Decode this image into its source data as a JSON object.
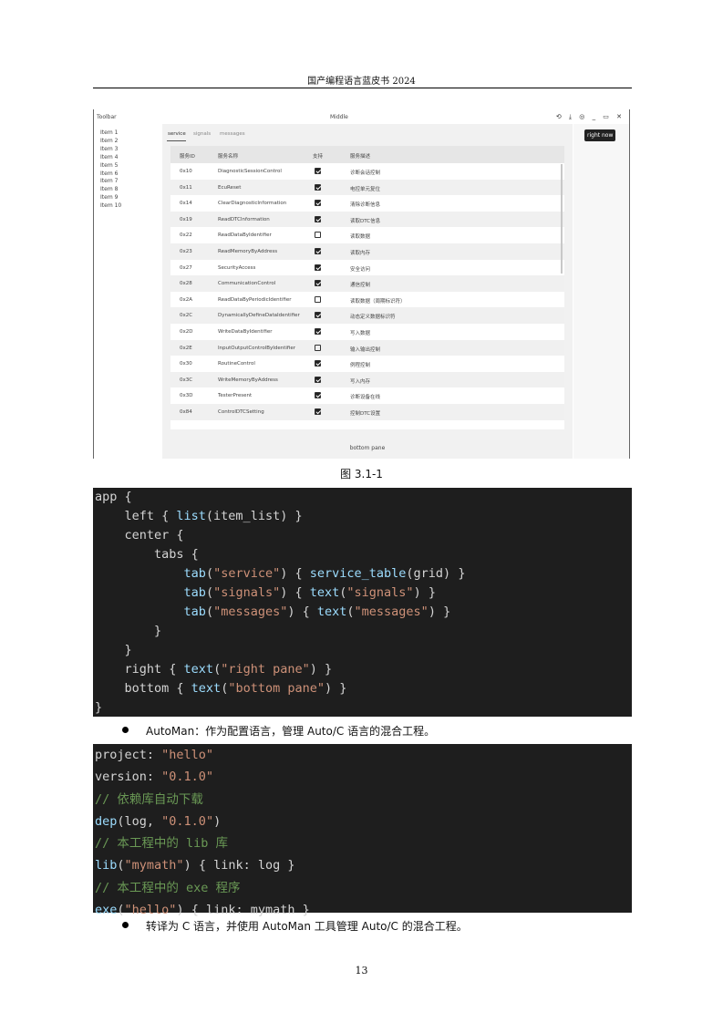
{
  "header": {
    "title": "国产编程语言蓝皮书 2024"
  },
  "figure": {
    "window": {
      "left_title": "Toolbar",
      "center_title": "Middle",
      "window_icons": "⟲ ⤓ ◎ _ ▭ ✕"
    },
    "sidebar": {
      "items": [
        "Item 1",
        "Item 2",
        "Item 3",
        "Item 4",
        "Item 5",
        "Item 6",
        "Item 7",
        "Item 8",
        "Item 9",
        "Item 10"
      ]
    },
    "tabs": [
      "service",
      "signals",
      "messages"
    ],
    "table": {
      "headers": [
        "服务ID",
        "服务名称",
        "支持",
        "服务描述"
      ],
      "rows": [
        {
          "id": "0x10",
          "name": "DiagnosticSessionControl",
          "supported": true,
          "desc": "诊断会话控制"
        },
        {
          "id": "0x11",
          "name": "EcuReset",
          "supported": true,
          "desc": "电控单元复位"
        },
        {
          "id": "0x14",
          "name": "ClearDiagnosticInformation",
          "supported": true,
          "desc": "清除诊断信息"
        },
        {
          "id": "0x19",
          "name": "ReadDTCInformation",
          "supported": true,
          "desc": "读取DTC信息"
        },
        {
          "id": "0x22",
          "name": "ReadDataByIdentifier",
          "supported": false,
          "desc": "读取数据"
        },
        {
          "id": "0x23",
          "name": "ReadMemoryByAddress",
          "supported": true,
          "desc": "读取内存"
        },
        {
          "id": "0x27",
          "name": "SecurityAccess",
          "supported": true,
          "desc": "安全访问"
        },
        {
          "id": "0x28",
          "name": "CommunicationControl",
          "supported": true,
          "desc": "通信控制"
        },
        {
          "id": "0x2A",
          "name": "ReadDataByPeriodicIdentifier",
          "supported": false,
          "desc": "读取数据（周期标识符）"
        },
        {
          "id": "0x2C",
          "name": "DynamicallyDefineDataIdentifier",
          "supported": true,
          "desc": "动态定义数据标识符"
        },
        {
          "id": "0x2D",
          "name": "WriteDataByIdentifier",
          "supported": true,
          "desc": "写入数据"
        },
        {
          "id": "0x2E",
          "name": "InputOutputControlByIdentifier",
          "supported": false,
          "desc": "输入输出控制"
        },
        {
          "id": "0x30",
          "name": "RoutineControl",
          "supported": true,
          "desc": "例程控制"
        },
        {
          "id": "0x3C",
          "name": "WriteMemoryByAddress",
          "supported": true,
          "desc": "写入内存"
        },
        {
          "id": "0x3D",
          "name": "TesterPresent",
          "supported": true,
          "desc": "诊断设备在线"
        },
        {
          "id": "0x84",
          "name": "ControlDTCSetting",
          "supported": true,
          "desc": "控制DTC设置"
        }
      ]
    },
    "right_button": "right now",
    "bottom_pane": "bottom pane"
  },
  "caption": "图 3.1-1",
  "bullets": [
    "AutoMan：作为配置语言，管理 Auto/C 语言的混合工程。",
    "转译为 C 语言，并使用 AutoMan 工具管理 Auto/C 的混合工程。"
  ],
  "page_number": "13"
}
